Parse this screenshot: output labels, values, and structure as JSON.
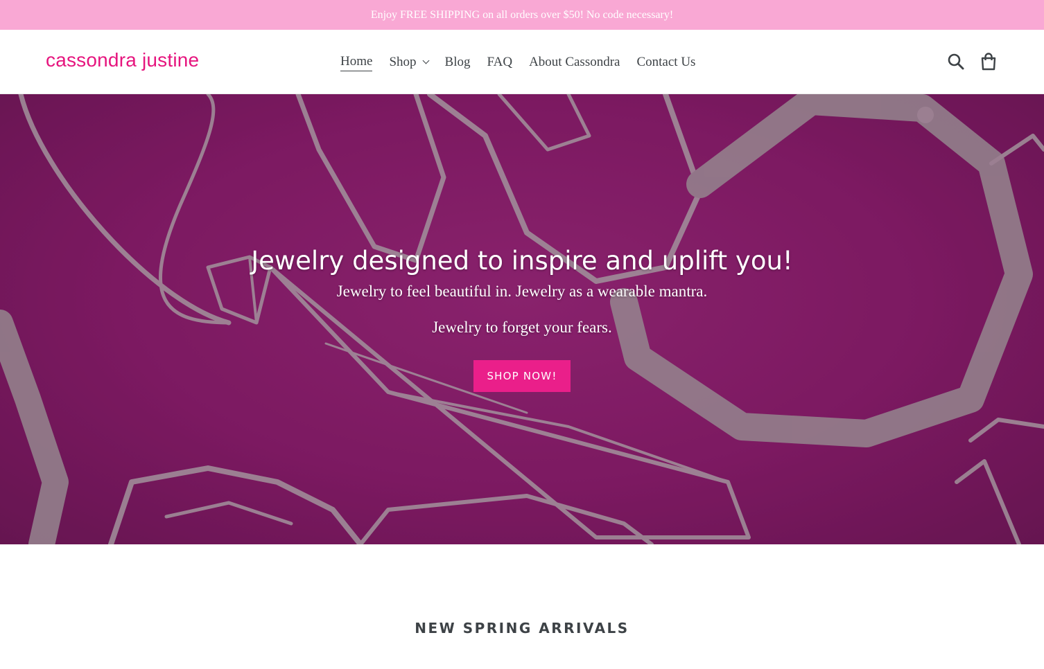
{
  "announcement": {
    "text": "Enjoy FREE SHIPPING on all orders over $50! No code necessary!"
  },
  "header": {
    "logo": "cassondra justine",
    "nav": [
      {
        "label": "Home",
        "active": true
      },
      {
        "label": "Shop",
        "has_dropdown": true
      },
      {
        "label": "Blog"
      },
      {
        "label": "FAQ"
      },
      {
        "label": "About Cassondra"
      },
      {
        "label": "Contact Us"
      }
    ],
    "icons": {
      "search": "search-icon",
      "cart": "cart-icon"
    }
  },
  "hero": {
    "title": "Jewelry designed to inspire and uplift you!",
    "subtitle_1": "Jewelry to feel beautiful in. Jewelry as a wearable mantra.",
    "subtitle_2": "Jewelry to forget your fears.",
    "cta": "SHOP NOW!"
  },
  "featured": {
    "title": "NEW SPRING ARRIVALS"
  },
  "colors": {
    "announcement_bg": "#f9a8d4",
    "brand_pink": "#e6157e",
    "cta_bg": "#ea1f8a",
    "hero_bg": "#8a1f6e",
    "text": "#3d4246"
  }
}
